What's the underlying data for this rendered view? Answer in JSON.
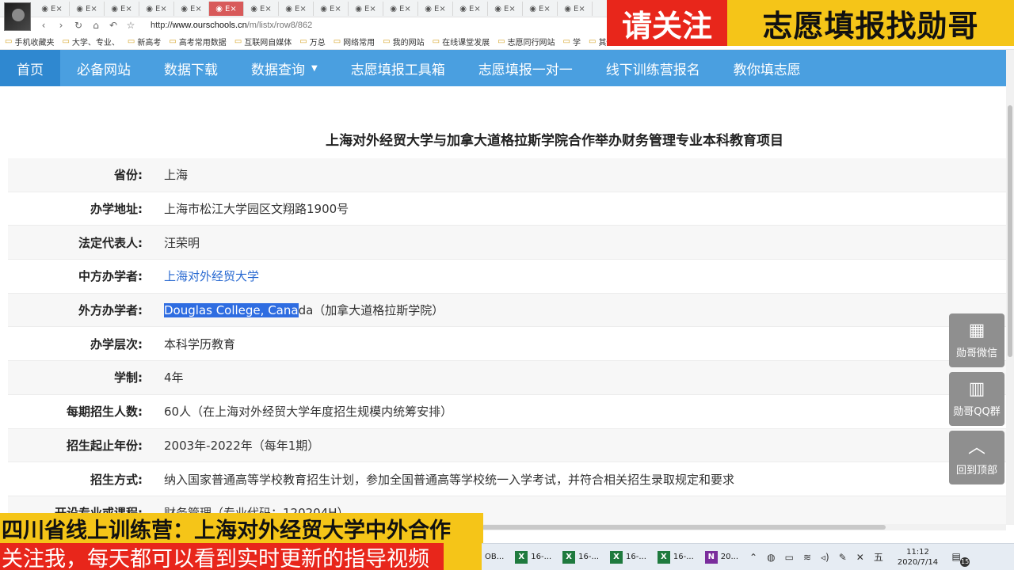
{
  "browser": {
    "tabs": [
      "E",
      "E",
      "E",
      "E",
      "E",
      "E",
      "E",
      "E",
      "E",
      "E",
      "E",
      "E",
      "E",
      "E",
      "E",
      "E"
    ],
    "active_tab_index": 5,
    "url_prefix": "http://",
    "url_host": "www.ourschools.cn",
    "url_path": "/m/listx/row8/862",
    "bookmarks": [
      "手机收藏夹",
      "大学、专业、",
      "新高考",
      "高考常用数据",
      "互联网自媒体",
      "万总",
      "网络常用",
      "我的网站",
      "在线课堂发展",
      "志愿同行网站",
      "学",
      "其他收藏"
    ]
  },
  "banner_top": {
    "left": "请关注",
    "right": "志愿填报找勋哥"
  },
  "site_nav": {
    "items": [
      "首页",
      "必备网站",
      "数据下载",
      "数据查询",
      "志愿填报工具箱",
      "志愿填报一对一",
      "线下训练营报名",
      "教你填志愿"
    ],
    "active_index": 0
  },
  "page_title": "上海对外经贸大学与加拿大道格拉斯学院合作举办财务管理专业本科教育项目",
  "info_rows": [
    {
      "label": "省份:",
      "value": "上海"
    },
    {
      "label": "办学地址:",
      "value": "上海市松江大学园区文翔路1900号"
    },
    {
      "label": "法定代表人:",
      "value": "汪荣明"
    },
    {
      "label": "中方办学者:",
      "value": "上海对外经贸大学"
    },
    {
      "label": "外方办学者:",
      "value_highlight": "Douglas College, Cana",
      "value": "da（加拿大道格拉斯学院）"
    },
    {
      "label": "办学层次:",
      "value": "本科学历教育"
    },
    {
      "label": "学制:",
      "value": "4年"
    },
    {
      "label": "每期招生人数:",
      "value": "60人（在上海对外经贸大学年度招生规模内统筹安排）"
    },
    {
      "label": "招生起止年份:",
      "value": "2003年-2022年（每年1期）"
    },
    {
      "label": "招生方式:",
      "value": "纳入国家普通高等学校教育招生计划，参加全国普通高等学校统一入学考试，并符合相关招生录取规定和要求"
    },
    {
      "label": "开设专业或课程:",
      "value": "财务管理（专业代码：120204H）"
    }
  ],
  "floats": [
    {
      "icon": "▦",
      "label": "勋哥微信"
    },
    {
      "icon": "▥",
      "label": "勋哥QQ群"
    },
    {
      "icon": "︿",
      "label": "回到顶部"
    }
  ],
  "bottom_banner": {
    "line1": "四川省线上训练营：上海对外经贸大学中外合作",
    "line2": "关注我，每天都可以看到实时更新的指导视频"
  },
  "taskbar": {
    "items": [
      {
        "type": "ob",
        "label": "OB..."
      },
      {
        "type": "excel",
        "label": "16-..."
      },
      {
        "type": "excel",
        "label": "16-..."
      },
      {
        "type": "excel",
        "label": "16-..."
      },
      {
        "type": "excel",
        "label": "16-..."
      },
      {
        "type": "onenote",
        "label": "20..."
      }
    ],
    "ime": "五",
    "time": "11:12",
    "date": "2020/7/14",
    "notifications": "15"
  },
  "colors": {
    "nav_bg": "#4a9fe0",
    "nav_active": "#2f88d0",
    "link": "#2a6ad1",
    "highlight": "#2f6de1",
    "banner_red": "#e8261b",
    "banner_yellow": "#f5c518"
  }
}
